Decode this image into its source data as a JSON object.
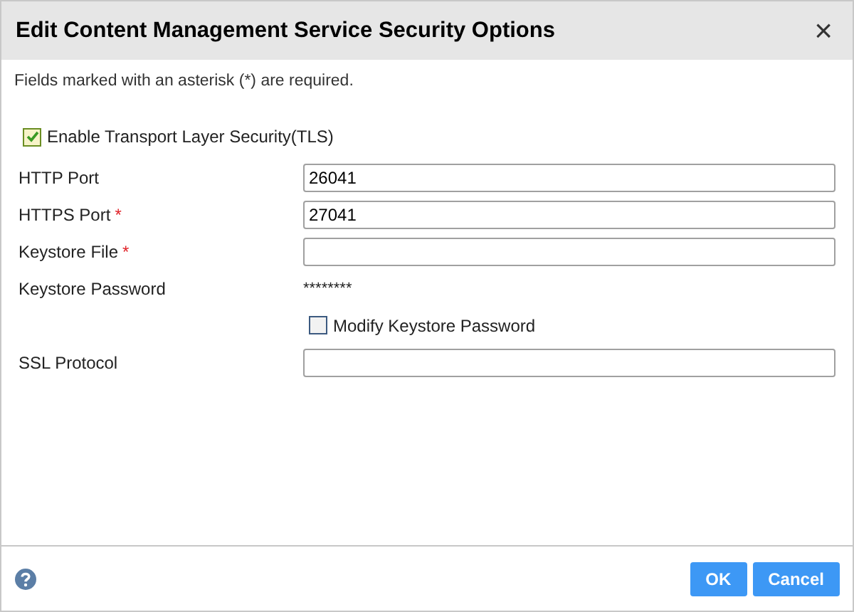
{
  "window": {
    "title": "Edit Content Management Service Security Options",
    "close": "×"
  },
  "note": "Fields marked with an asterisk (*) are required.",
  "rows": [
    {
      "kind": "checkbox",
      "label": "Enable Transport Layer Security(TLS)",
      "checked": true
    },
    {
      "kind": "input",
      "label": "HTTP Port",
      "value": "26041"
    },
    {
      "kind": "input",
      "label": "HTTPS Port",
      "value": "27041",
      "required_mark": "*"
    },
    {
      "kind": "input",
      "label": "Keystore File",
      "value": "",
      "required_mark": "*"
    },
    {
      "kind": "text",
      "label": "Keystore Password",
      "value": "********"
    },
    {
      "kind": "option",
      "label": "Modify Keystore Password",
      "checked": false
    },
    {
      "kind": "input",
      "label": "SSL Protocol",
      "value": ""
    }
  ],
  "buttons": [
    {
      "label": "OK"
    },
    {
      "label": "Cancel"
    }
  ]
}
